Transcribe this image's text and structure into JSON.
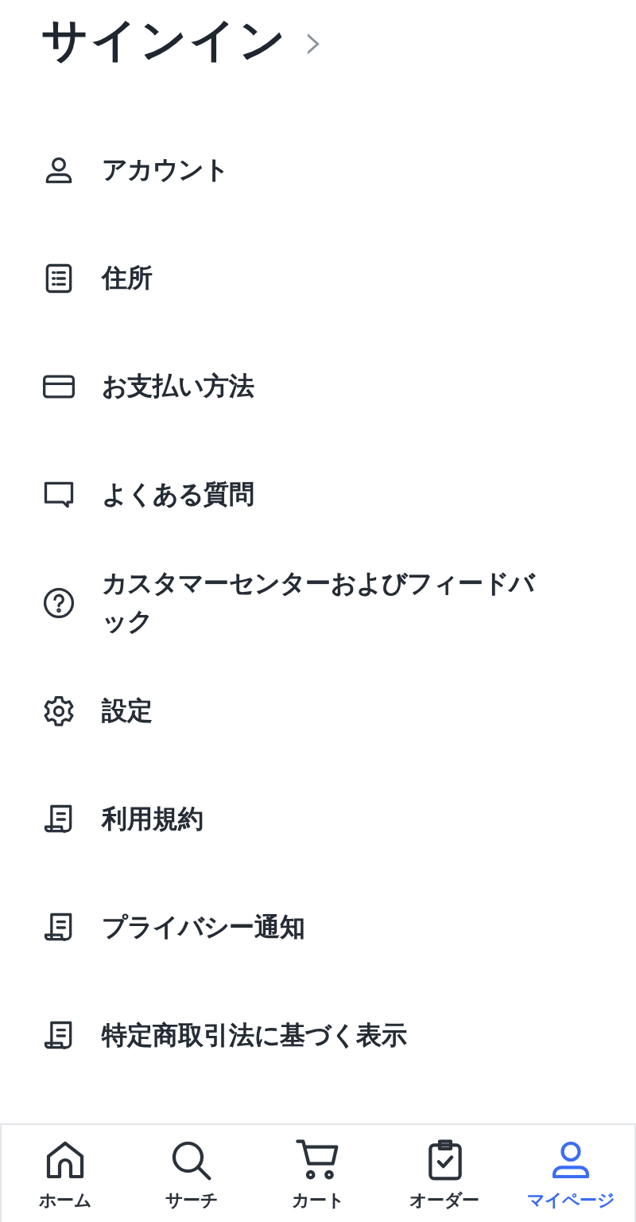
{
  "header": {
    "title": "サインイン",
    "chevron": "›"
  },
  "menu": [
    {
      "kind": "account",
      "label": "アカウント"
    },
    {
      "kind": "address",
      "label": "住所"
    },
    {
      "kind": "payment",
      "label": "お支払い方法"
    },
    {
      "kind": "faq",
      "label": "よくある質問"
    },
    {
      "kind": "help",
      "label": "カスタマーセンターおよびフィードバック"
    },
    {
      "kind": "settings",
      "label": "設定"
    },
    {
      "kind": "document",
      "label": "利用規約"
    },
    {
      "kind": "document",
      "label": "プライバシー通知"
    },
    {
      "kind": "document",
      "label": "特定商取引法に基づく表示"
    }
  ],
  "tab_bar": [
    {
      "kind": "home",
      "label": "ホーム",
      "selected": false
    },
    {
      "kind": "search",
      "label": "サーチ",
      "selected": false
    },
    {
      "kind": "cart",
      "label": "カート",
      "selected": false
    },
    {
      "kind": "orders",
      "label": "オーダー",
      "selected": false
    },
    {
      "kind": "mypage",
      "label": "マイページ",
      "selected": true
    }
  ]
}
